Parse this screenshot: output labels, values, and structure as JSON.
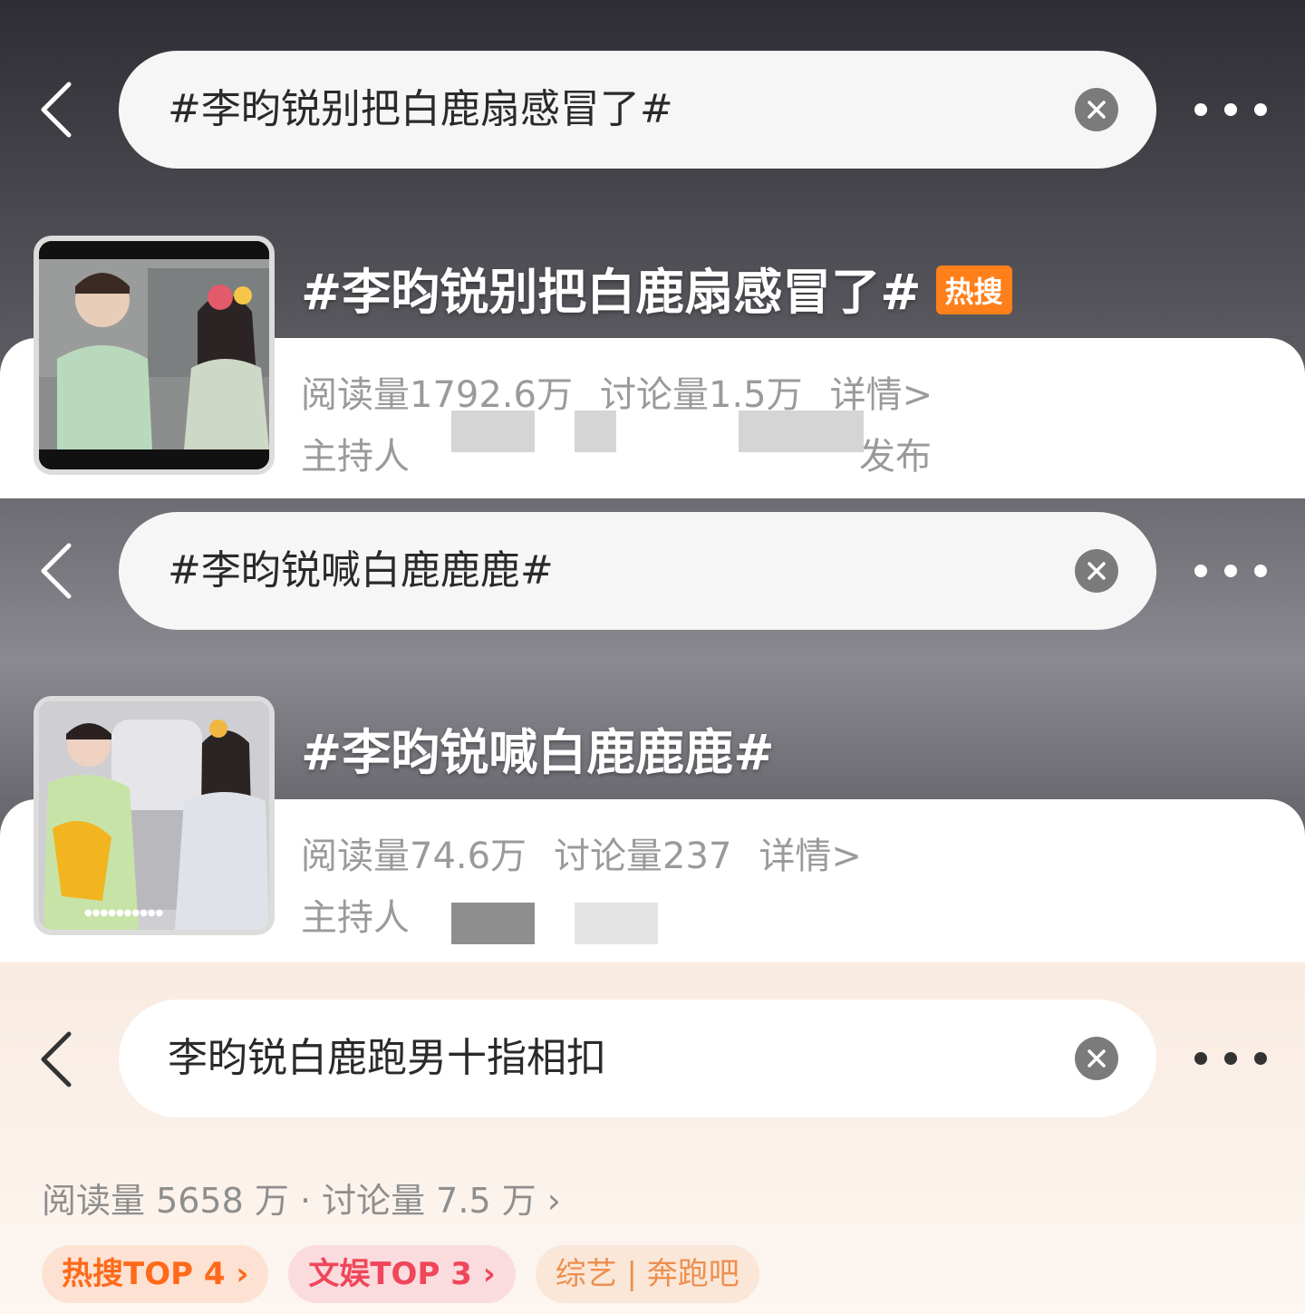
{
  "colors": {
    "hot_badge": "#ff7f1a",
    "tag_hot_text": "#ff6a1a",
    "tag_ent_text": "#f0465a",
    "tag_var_text": "#ee8f50"
  },
  "topic1": {
    "search_text": "#李昀锐别把白鹿扇感冒了#",
    "title": "#李昀锐别把白鹿扇感冒了#",
    "badge": "热搜",
    "reads": "阅读量1792.6万",
    "discussions": "讨论量1.5万",
    "details": "详情>",
    "host_label": "主持人",
    "published": "发布"
  },
  "topic2": {
    "search_text": "#李昀锐喊白鹿鹿鹿#",
    "title": "#李昀锐喊白鹿鹿鹿#",
    "reads": "阅读量74.6万",
    "discussions": "讨论量237",
    "details": "详情>",
    "host_label": "主持人"
  },
  "topic3": {
    "search_text": "李昀锐白鹿跑男十指相扣",
    "stats": "阅读量 5658 万 · 讨论量 7.5 万 ›",
    "tags": [
      "热搜TOP 4 ›",
      "文娱TOP 3 ›",
      "综艺 | 奔跑吧"
    ]
  },
  "icons": {
    "back": "back-arrow-icon",
    "clear": "close-icon",
    "more": "more-dots-icon"
  }
}
